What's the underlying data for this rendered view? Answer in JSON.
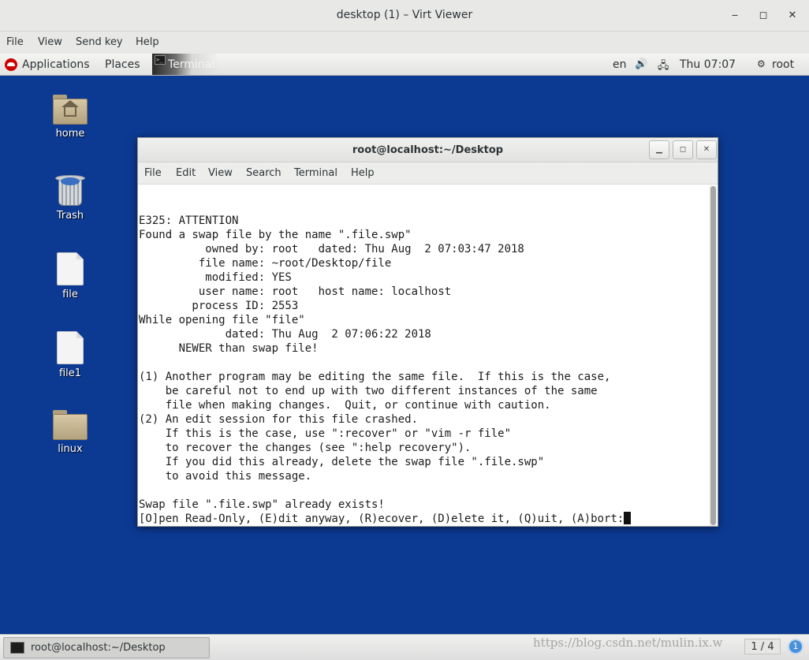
{
  "window": {
    "title": "desktop (1) – Virt Viewer",
    "minimize": "‒",
    "maximize": "◻",
    "close": "✕",
    "menu": [
      "File",
      "View",
      "Send key",
      "Help"
    ]
  },
  "gnome_bar": {
    "applications": "Applications",
    "places": "Places",
    "active_app": "Terminal",
    "lang": "en",
    "volume_icon": "🔊",
    "network_icon": "🖧",
    "clock": "Thu 07:07",
    "user_icon": "⚙",
    "user": "root"
  },
  "desktop_icons": [
    {
      "label": "home"
    },
    {
      "label": "Trash"
    },
    {
      "label": "file"
    },
    {
      "label": "file1"
    },
    {
      "label": "linux"
    }
  ],
  "terminal": {
    "title": "root@localhost:~/Desktop",
    "menu": [
      "File",
      "Edit",
      "View",
      "Search",
      "Terminal",
      "Help"
    ],
    "lines": [
      "",
      "E325: ATTENTION",
      "Found a swap file by the name \".file.swp\"",
      "          owned by: root   dated: Thu Aug  2 07:03:47 2018",
      "         file name: ~root/Desktop/file",
      "          modified: YES",
      "         user name: root   host name: localhost",
      "        process ID: 2553",
      "While opening file \"file\"",
      "             dated: Thu Aug  2 07:06:22 2018",
      "      NEWER than swap file!",
      "",
      "(1) Another program may be editing the same file.  If this is the case,",
      "    be careful not to end up with two different instances of the same",
      "    file when making changes.  Quit, or continue with caution.",
      "(2) An edit session for this file crashed.",
      "    If this is the case, use \":recover\" or \"vim -r file\"",
      "    to recover the changes (see \":help recovery\").",
      "    If you did this already, delete the swap file \".file.swp\"",
      "    to avoid this message.",
      "",
      "Swap file \".file.swp\" already exists!"
    ],
    "prompt": "[O]pen Read-Only, (E)dit anyway, (R)ecover, (D)elete it, (Q)uit, (A)bort:"
  },
  "taskbar": {
    "item_label": "root@localhost:~/Desktop",
    "watermark": "https://blog.csdn.net/mulin.ix.w",
    "pager": "1 / 4",
    "notifications": "1"
  }
}
